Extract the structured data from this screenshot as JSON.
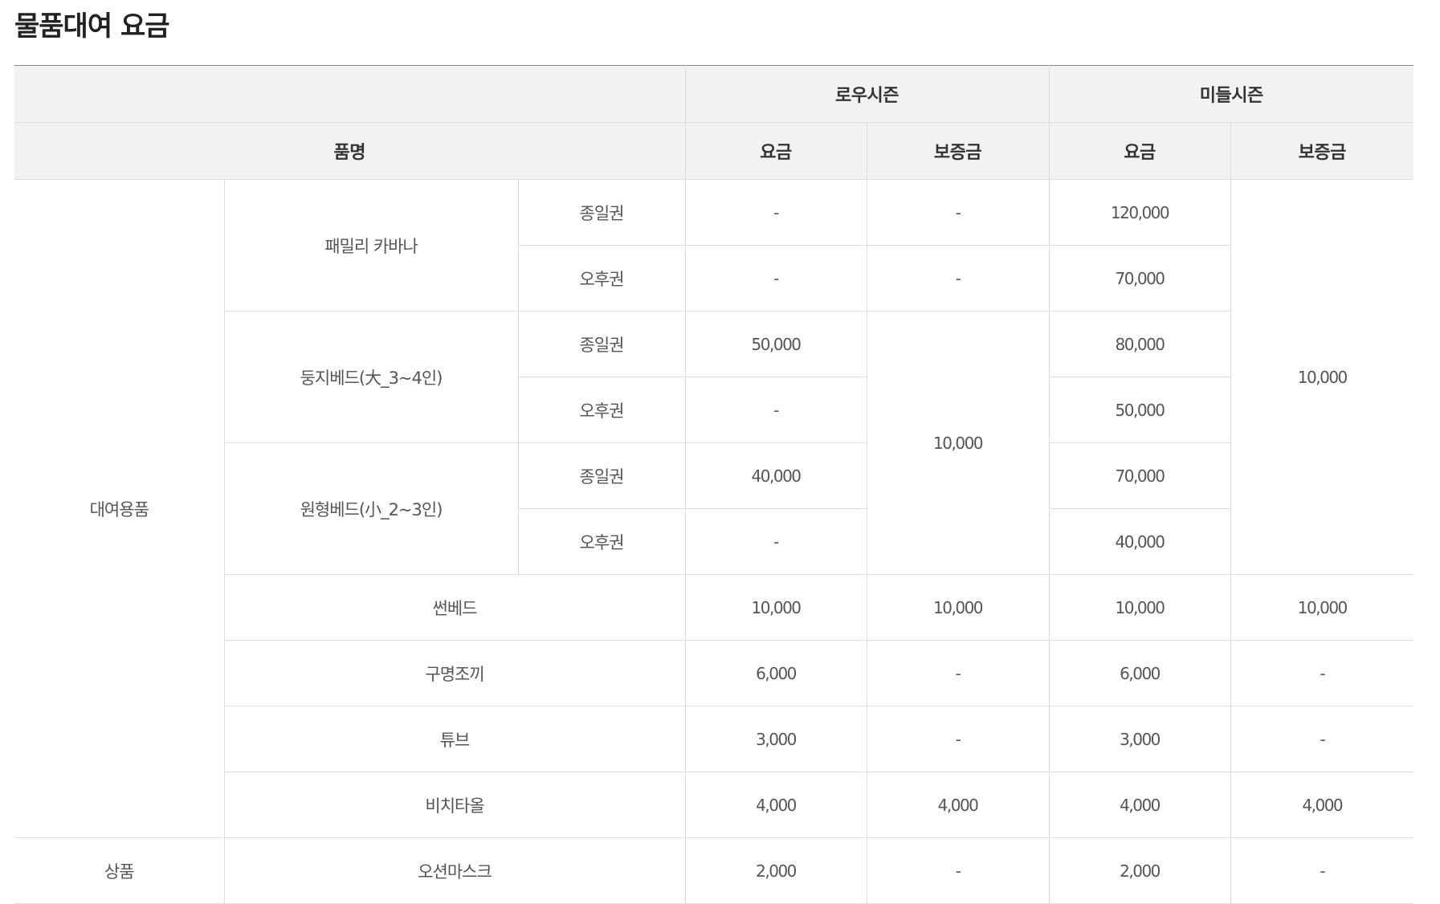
{
  "title": "물품대여 요금",
  "header": {
    "low_season": "로우시즌",
    "middle_season": "미들시즌",
    "item_name": "품명",
    "fee": "요금",
    "deposit": "보증금"
  },
  "categories": {
    "rental": "대여용품",
    "goods": "상품"
  },
  "items": {
    "family_cabana": {
      "name": "패밀리 카바나",
      "full_day": {
        "label": "종일권",
        "low_fee": "-",
        "low_deposit": "-",
        "mid_fee": "120,000"
      },
      "afternoon": {
        "label": "오후권",
        "low_fee": "-",
        "low_deposit": "-",
        "mid_fee": "70,000"
      }
    },
    "nest_bed": {
      "name": "둥지베드(大_3~4인)",
      "full_day": {
        "label": "종일권",
        "low_fee": "50,000",
        "mid_fee": "80,000"
      },
      "afternoon": {
        "label": "오후권",
        "low_fee": "-",
        "mid_fee": "50,000"
      }
    },
    "round_bed": {
      "name": "원형베드(小_2~3인)",
      "full_day": {
        "label": "종일권",
        "low_fee": "40,000",
        "mid_fee": "70,000"
      },
      "afternoon": {
        "label": "오후권",
        "low_fee": "-",
        "mid_fee": "40,000"
      }
    },
    "bed_low_deposit": "10,000",
    "bed_mid_deposit": "10,000",
    "sunbed": {
      "name": "썬베드",
      "low_fee": "10,000",
      "low_deposit": "10,000",
      "mid_fee": "10,000",
      "mid_deposit": "10,000"
    },
    "life_jacket": {
      "name": "구명조끼",
      "low_fee": "6,000",
      "low_deposit": "-",
      "mid_fee": "6,000",
      "mid_deposit": "-"
    },
    "tube": {
      "name": "튜브",
      "low_fee": "3,000",
      "low_deposit": "-",
      "mid_fee": "3,000",
      "mid_deposit": "-"
    },
    "beach_towel": {
      "name": "비치타올",
      "low_fee": "4,000",
      "low_deposit": "4,000",
      "mid_fee": "4,000",
      "mid_deposit": "4,000"
    },
    "ocean_mask": {
      "name": "오션마스크",
      "low_fee": "2,000",
      "low_deposit": "-",
      "mid_fee": "2,000",
      "mid_deposit": "-"
    }
  }
}
